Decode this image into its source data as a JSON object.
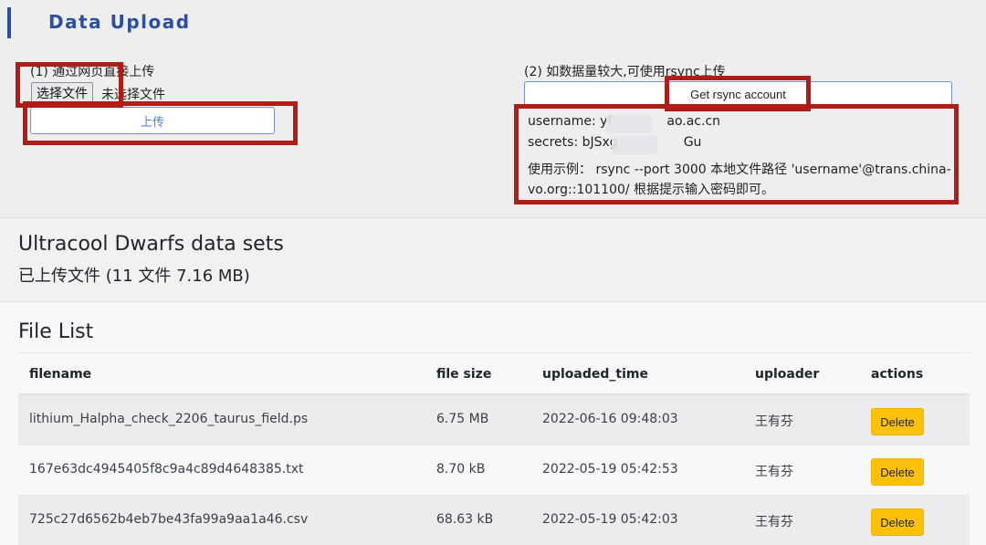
{
  "header": {
    "title": "Data Upload",
    "accent_color": "#2d4fa0"
  },
  "web_upload": {
    "label": "(1) 通过网页直接上传",
    "choose_button": "选择文件",
    "no_file_text": "未选择文件",
    "upload_button": "上传"
  },
  "rsync": {
    "label": "(2) 如数据量较大,可使用rsync上传",
    "button": "Get rsync account",
    "username_prefix": "username: yf",
    "username_suffix": "ao.ac.cn",
    "secrets_prefix": "secrets: bJSxg",
    "secrets_suffix": "Gu",
    "example_line1": "使用示例： rsync --port 3000 本地文件路径 'username'@trans.china-",
    "example_line2": "vo.org::101100/ 根据提示输入密码即可。"
  },
  "dataset": {
    "title": "Ultracool Dwarfs data sets",
    "summary": "已上传文件 (11 文件 7.16 MB)"
  },
  "file_list": {
    "title": "File List",
    "columns": {
      "filename": "filename",
      "size": "file size",
      "time": "uploaded_time",
      "uploader": "uploader",
      "actions": "actions"
    },
    "rows": [
      {
        "filename": "lithium_Halpha_check_2206_taurus_field.ps",
        "size": "6.75 MB",
        "time": "2022-06-16 09:48:03",
        "uploader": "王有芬",
        "action": "Delete"
      },
      {
        "filename": "167e63dc4945405f8c9a4c89d4648385.txt",
        "size": "8.70 kB",
        "time": "2022-05-19 05:42:53",
        "uploader": "王有芬",
        "action": "Delete"
      },
      {
        "filename": "725c27d6562b4eb7be43fa99a9aa1a46.csv",
        "size": "68.63 kB",
        "time": "2022-05-19 05:42:03",
        "uploader": "王有芬",
        "action": "Delete"
      }
    ]
  },
  "colors": {
    "annotation_red": "#b01c17",
    "delete_yellow": "#ffc107",
    "button_blue": "#6f93d8"
  }
}
